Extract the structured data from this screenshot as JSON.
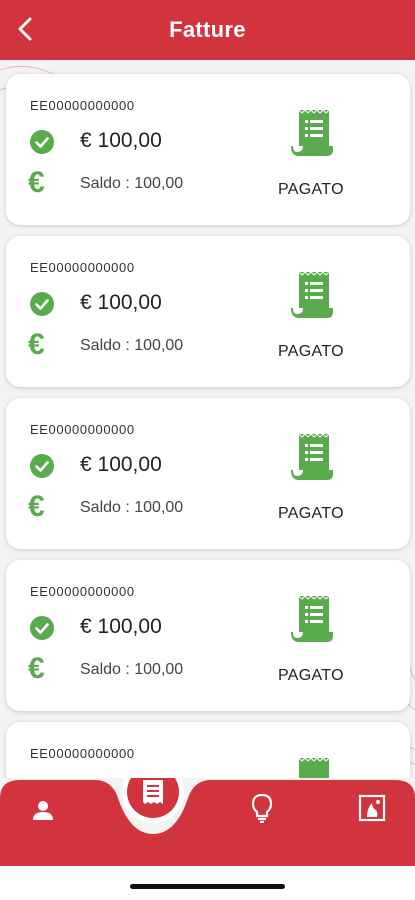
{
  "header": {
    "title": "Fatture",
    "back_icon": "chevron-left-icon"
  },
  "colors": {
    "brand": "#d1343c",
    "paid": "#5aaa4e",
    "background": "#f3f3f3"
  },
  "invoices": [
    {
      "code": "EE00000000000",
      "amount": "€ 100,00",
      "saldo": "Saldo : 100,00",
      "status": "PAGATO"
    },
    {
      "code": "EE00000000000",
      "amount": "€ 100,00",
      "saldo": "Saldo : 100,00",
      "status": "PAGATO"
    },
    {
      "code": "EE00000000000",
      "amount": "€ 100,00",
      "saldo": "Saldo : 100,00",
      "status": "PAGATO"
    },
    {
      "code": "EE00000000000",
      "amount": "€ 100,00",
      "saldo": "Saldo : 100,00",
      "status": "PAGATO"
    },
    {
      "code": "EE00000000000",
      "amount": "",
      "saldo": "",
      "status": ""
    }
  ],
  "icons": {
    "check": "check-circle-icon",
    "euro": "euro-icon",
    "receipt": "receipt-icon"
  },
  "euro_symbol": "€",
  "bottom_nav": [
    {
      "id": "profile",
      "icon": "user-icon"
    },
    {
      "id": "invoices",
      "icon": "receipt-icon",
      "active": true
    },
    {
      "id": "tips",
      "icon": "lightbulb-icon"
    },
    {
      "id": "gallery",
      "icon": "image-icon"
    }
  ]
}
